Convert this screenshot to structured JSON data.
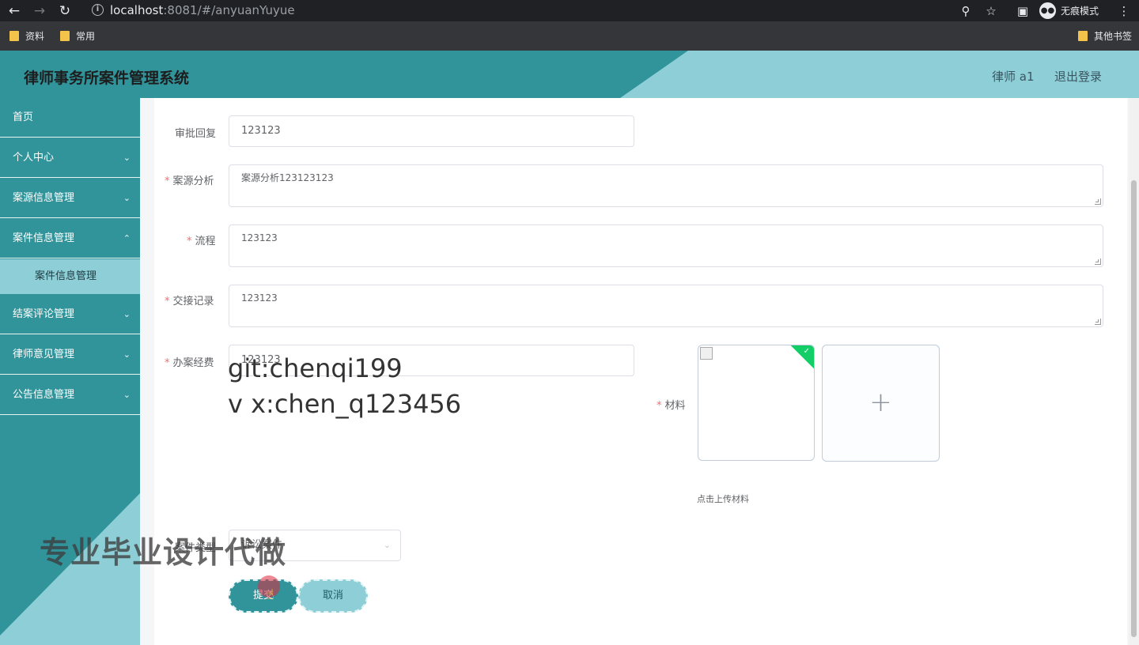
{
  "browser": {
    "url_host": "localhost",
    "url_rest": ":8081/#/anyuanYuyue",
    "incognito_label": "无痕模式",
    "bookmarks": [
      "资料",
      "常用"
    ],
    "other_bookmarks": "其他书签",
    "folder_color": "#f3c34a"
  },
  "header": {
    "title": "律师事务所案件管理系统",
    "user_role": "律师 a1",
    "logout_label": "退出登录"
  },
  "sidebar": {
    "items": [
      {
        "label": "首页"
      },
      {
        "label": "个人中心"
      },
      {
        "label": "案源信息管理"
      },
      {
        "label": "案件信息管理"
      },
      {
        "label": "结案评论管理"
      },
      {
        "label": "律师意见管理"
      },
      {
        "label": "公告信息管理"
      }
    ],
    "active_sub": "案件信息管理"
  },
  "form": {
    "approval_reply": {
      "label": "审批回复",
      "value": "123123"
    },
    "case_analysis": {
      "label": "案源分析",
      "value": "案源分析123123123"
    },
    "process": {
      "label": "流程",
      "value": "123123"
    },
    "handover": {
      "label": "交接记录",
      "value": "123123"
    },
    "expense": {
      "label": "办案经费",
      "value": "123123"
    },
    "materials": {
      "label": "材料",
      "tip": "点击上传材料"
    },
    "case_type": {
      "label": "案件类型",
      "value": "诉讼案件"
    },
    "submit_label": "提交",
    "cancel_label": "取消"
  },
  "watermarks": {
    "line1": "git:chenqi199",
    "line2": "v x:chen_q123456",
    "line3": "专业毕业设计代做"
  },
  "colors": {
    "primary": "#31949b",
    "light": "#8ecfd7",
    "required": "#f56c6c",
    "success": "#13ce66"
  },
  "icons": {
    "back": "arrow-left-icon",
    "forward": "arrow-right-icon",
    "reload": "reload-icon",
    "info": "info-icon",
    "key": "key-icon",
    "star": "star-icon",
    "sidebar_toggle": "sidebar-toggle-icon",
    "menu": "kebab-menu-icon",
    "chevron": "chevron-down-icon",
    "plus": "plus-icon"
  }
}
